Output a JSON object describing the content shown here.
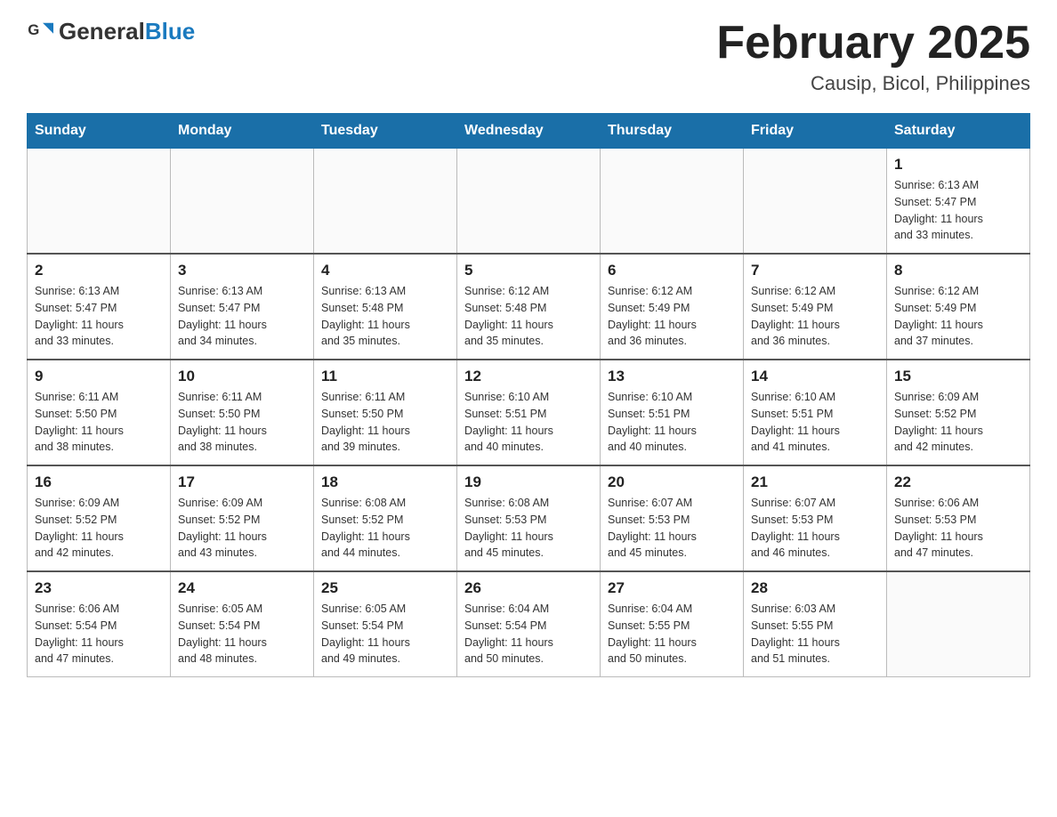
{
  "header": {
    "logo_general": "General",
    "logo_blue": "Blue",
    "month_title": "February 2025",
    "location": "Causip, Bicol, Philippines"
  },
  "days_of_week": [
    "Sunday",
    "Monday",
    "Tuesday",
    "Wednesday",
    "Thursday",
    "Friday",
    "Saturday"
  ],
  "weeks": [
    {
      "days": [
        {
          "number": "",
          "info": ""
        },
        {
          "number": "",
          "info": ""
        },
        {
          "number": "",
          "info": ""
        },
        {
          "number": "",
          "info": ""
        },
        {
          "number": "",
          "info": ""
        },
        {
          "number": "",
          "info": ""
        },
        {
          "number": "1",
          "info": "Sunrise: 6:13 AM\nSunset: 5:47 PM\nDaylight: 11 hours\nand 33 minutes."
        }
      ]
    },
    {
      "days": [
        {
          "number": "2",
          "info": "Sunrise: 6:13 AM\nSunset: 5:47 PM\nDaylight: 11 hours\nand 33 minutes."
        },
        {
          "number": "3",
          "info": "Sunrise: 6:13 AM\nSunset: 5:47 PM\nDaylight: 11 hours\nand 34 minutes."
        },
        {
          "number": "4",
          "info": "Sunrise: 6:13 AM\nSunset: 5:48 PM\nDaylight: 11 hours\nand 35 minutes."
        },
        {
          "number": "5",
          "info": "Sunrise: 6:12 AM\nSunset: 5:48 PM\nDaylight: 11 hours\nand 35 minutes."
        },
        {
          "number": "6",
          "info": "Sunrise: 6:12 AM\nSunset: 5:49 PM\nDaylight: 11 hours\nand 36 minutes."
        },
        {
          "number": "7",
          "info": "Sunrise: 6:12 AM\nSunset: 5:49 PM\nDaylight: 11 hours\nand 36 minutes."
        },
        {
          "number": "8",
          "info": "Sunrise: 6:12 AM\nSunset: 5:49 PM\nDaylight: 11 hours\nand 37 minutes."
        }
      ]
    },
    {
      "days": [
        {
          "number": "9",
          "info": "Sunrise: 6:11 AM\nSunset: 5:50 PM\nDaylight: 11 hours\nand 38 minutes."
        },
        {
          "number": "10",
          "info": "Sunrise: 6:11 AM\nSunset: 5:50 PM\nDaylight: 11 hours\nand 38 minutes."
        },
        {
          "number": "11",
          "info": "Sunrise: 6:11 AM\nSunset: 5:50 PM\nDaylight: 11 hours\nand 39 minutes."
        },
        {
          "number": "12",
          "info": "Sunrise: 6:10 AM\nSunset: 5:51 PM\nDaylight: 11 hours\nand 40 minutes."
        },
        {
          "number": "13",
          "info": "Sunrise: 6:10 AM\nSunset: 5:51 PM\nDaylight: 11 hours\nand 40 minutes."
        },
        {
          "number": "14",
          "info": "Sunrise: 6:10 AM\nSunset: 5:51 PM\nDaylight: 11 hours\nand 41 minutes."
        },
        {
          "number": "15",
          "info": "Sunrise: 6:09 AM\nSunset: 5:52 PM\nDaylight: 11 hours\nand 42 minutes."
        }
      ]
    },
    {
      "days": [
        {
          "number": "16",
          "info": "Sunrise: 6:09 AM\nSunset: 5:52 PM\nDaylight: 11 hours\nand 42 minutes."
        },
        {
          "number": "17",
          "info": "Sunrise: 6:09 AM\nSunset: 5:52 PM\nDaylight: 11 hours\nand 43 minutes."
        },
        {
          "number": "18",
          "info": "Sunrise: 6:08 AM\nSunset: 5:52 PM\nDaylight: 11 hours\nand 44 minutes."
        },
        {
          "number": "19",
          "info": "Sunrise: 6:08 AM\nSunset: 5:53 PM\nDaylight: 11 hours\nand 45 minutes."
        },
        {
          "number": "20",
          "info": "Sunrise: 6:07 AM\nSunset: 5:53 PM\nDaylight: 11 hours\nand 45 minutes."
        },
        {
          "number": "21",
          "info": "Sunrise: 6:07 AM\nSunset: 5:53 PM\nDaylight: 11 hours\nand 46 minutes."
        },
        {
          "number": "22",
          "info": "Sunrise: 6:06 AM\nSunset: 5:53 PM\nDaylight: 11 hours\nand 47 minutes."
        }
      ]
    },
    {
      "days": [
        {
          "number": "23",
          "info": "Sunrise: 6:06 AM\nSunset: 5:54 PM\nDaylight: 11 hours\nand 47 minutes."
        },
        {
          "number": "24",
          "info": "Sunrise: 6:05 AM\nSunset: 5:54 PM\nDaylight: 11 hours\nand 48 minutes."
        },
        {
          "number": "25",
          "info": "Sunrise: 6:05 AM\nSunset: 5:54 PM\nDaylight: 11 hours\nand 49 minutes."
        },
        {
          "number": "26",
          "info": "Sunrise: 6:04 AM\nSunset: 5:54 PM\nDaylight: 11 hours\nand 50 minutes."
        },
        {
          "number": "27",
          "info": "Sunrise: 6:04 AM\nSunset: 5:55 PM\nDaylight: 11 hours\nand 50 minutes."
        },
        {
          "number": "28",
          "info": "Sunrise: 6:03 AM\nSunset: 5:55 PM\nDaylight: 11 hours\nand 51 minutes."
        },
        {
          "number": "",
          "info": ""
        }
      ]
    }
  ]
}
